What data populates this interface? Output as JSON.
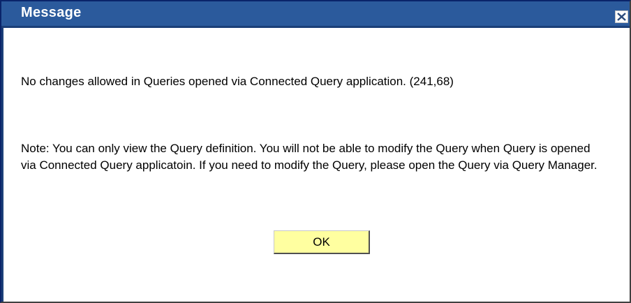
{
  "dialog": {
    "title": "Message",
    "close_icon": "close-icon",
    "message": "No changes allowed in Queries opened via Connected Query application. (241,68)",
    "note": "Note: You can only view the Query definition. You will not be able to modify the Query when Query is opened via Connected Query applicatoin. If you need to modify the Query, please open the Query via Query Manager.",
    "ok_label": "OK"
  },
  "colors": {
    "titlebar": "#2b5a9c",
    "ok_button": "#ffffa0"
  }
}
